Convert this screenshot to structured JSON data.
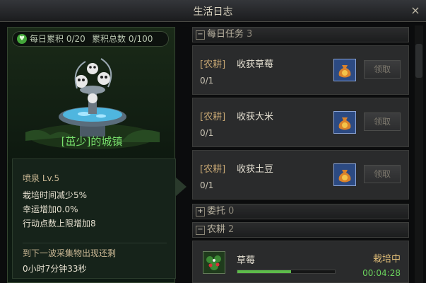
{
  "window": {
    "title": "生活日志",
    "close_glyph": "×"
  },
  "town": {
    "daily_accumulated": "每日累积 0/20",
    "total_accumulated": "累积总数 0/100",
    "name": "[茁少]的城镇"
  },
  "building": {
    "name": "喷泉   Lv.5",
    "bonuses": [
      "栽培时间减少5%",
      "幸运增加0.0%",
      "行动点数上限增加8"
    ],
    "respawn_label": "到下一波采集物出现还剩",
    "respawn_time": "0小时7分钟33秒"
  },
  "sections": {
    "daily": {
      "toggle": "−",
      "title": "每日任务",
      "count": "3"
    },
    "commission": {
      "toggle": "+",
      "title": "委托",
      "count": "0"
    },
    "farming": {
      "toggle": "−",
      "title": "农耕",
      "count": "2"
    }
  },
  "tasks": [
    {
      "tag": "[农耕]",
      "name": "收获草莓",
      "progress": "0/1",
      "claim": "领取"
    },
    {
      "tag": "[农耕]",
      "name": "收获大米",
      "progress": "0/1",
      "claim": "领取"
    },
    {
      "tag": "[农耕]",
      "name": "收获土豆",
      "progress": "0/1",
      "claim": "领取"
    }
  ],
  "crop": {
    "name": "草莓",
    "status": "栽培中",
    "timer": "00:04:28",
    "progress": 0.55
  },
  "icons": {
    "heart": "heart-icon",
    "reward": "gold-pouch-icon",
    "crop": "strawberry-plant-icon",
    "close": "close-icon"
  },
  "colors": {
    "town_name": "#78e06c",
    "crop_status": "#e6c27a",
    "timer": "#6ad15c",
    "task_tag": "#c8a874"
  }
}
